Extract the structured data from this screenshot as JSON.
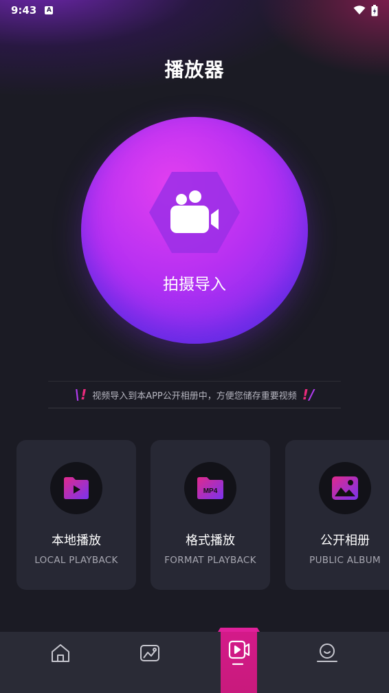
{
  "status_bar": {
    "time": "9:43",
    "app_icon_letter": "A",
    "icons": [
      "wifi-icon",
      "battery-charging-icon"
    ]
  },
  "header": {
    "title": "播放器"
  },
  "record": {
    "label": "拍摄导入",
    "icon": "video-camera-icon"
  },
  "notice": {
    "text": "视频导入到本APP公开相册中，方便您储存重要视频",
    "decoration": "!!"
  },
  "cards": [
    {
      "title": "本地播放",
      "subtitle": "LOCAL PLAYBACK",
      "icon": "folder-play-icon"
    },
    {
      "title": "格式播放",
      "subtitle": "FORMAT PLAYBACK",
      "icon": "mp4-folder-icon",
      "badge": "MP4"
    },
    {
      "title": "公开相册",
      "subtitle": "PUBLIC ALBUM",
      "icon": "image-icon"
    }
  ],
  "tabbar": {
    "tabs": [
      "home-icon",
      "gallery-icon",
      "video-player-icon",
      "profile-icon"
    ],
    "active_index": 2
  },
  "colors": {
    "accent_pink": "#d41a8a",
    "accent_purple": "#8a2ff0",
    "background": "#1b1b24",
    "card": "#272834"
  }
}
